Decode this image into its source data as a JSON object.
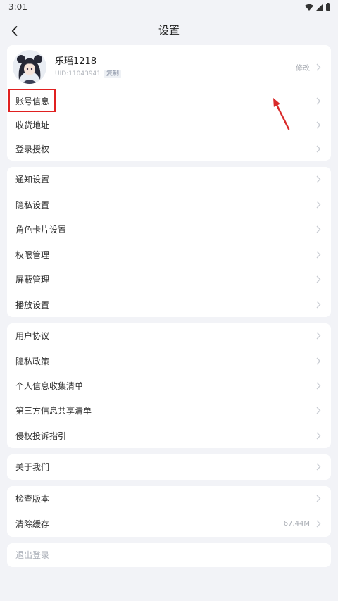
{
  "status_bar": {
    "time": "3:01",
    "icons": [
      "wifi-icon",
      "signal-icon",
      "battery-icon"
    ]
  },
  "header": {
    "title": "设置",
    "back_icon": "chevron-left-icon"
  },
  "profile": {
    "name": "乐瑶1218",
    "uid": "UID:11043941",
    "copy_label": "复制",
    "edit_label": "修改"
  },
  "groups": [
    {
      "items": [
        {
          "label": "账号信息",
          "highlighted": true
        },
        {
          "label": "收货地址"
        },
        {
          "label": "登录授权"
        }
      ]
    },
    {
      "items": [
        {
          "label": "通知设置"
        },
        {
          "label": "隐私设置"
        },
        {
          "label": "角色卡片设置"
        },
        {
          "label": "权限管理"
        },
        {
          "label": "屏蔽管理"
        },
        {
          "label": "播放设置"
        }
      ]
    },
    {
      "items": [
        {
          "label": "用户协议"
        },
        {
          "label": "隐私政策"
        },
        {
          "label": "个人信息收集清单"
        },
        {
          "label": "第三方信息共享清单"
        },
        {
          "label": "侵权投诉指引"
        }
      ]
    },
    {
      "items": [
        {
          "label": "关于我们"
        }
      ]
    },
    {
      "items": [
        {
          "label": "检查版本"
        },
        {
          "label": "清除缓存",
          "value": "67.44M"
        }
      ]
    }
  ],
  "logout": {
    "label": "退出登录"
  },
  "item_icon": "chevron-right-icon",
  "colors": {
    "background": "#f2f3f7",
    "card": "#ffffff",
    "text": "#2e2e2e",
    "muted": "#a9adb4",
    "annotation": "#e02020"
  }
}
